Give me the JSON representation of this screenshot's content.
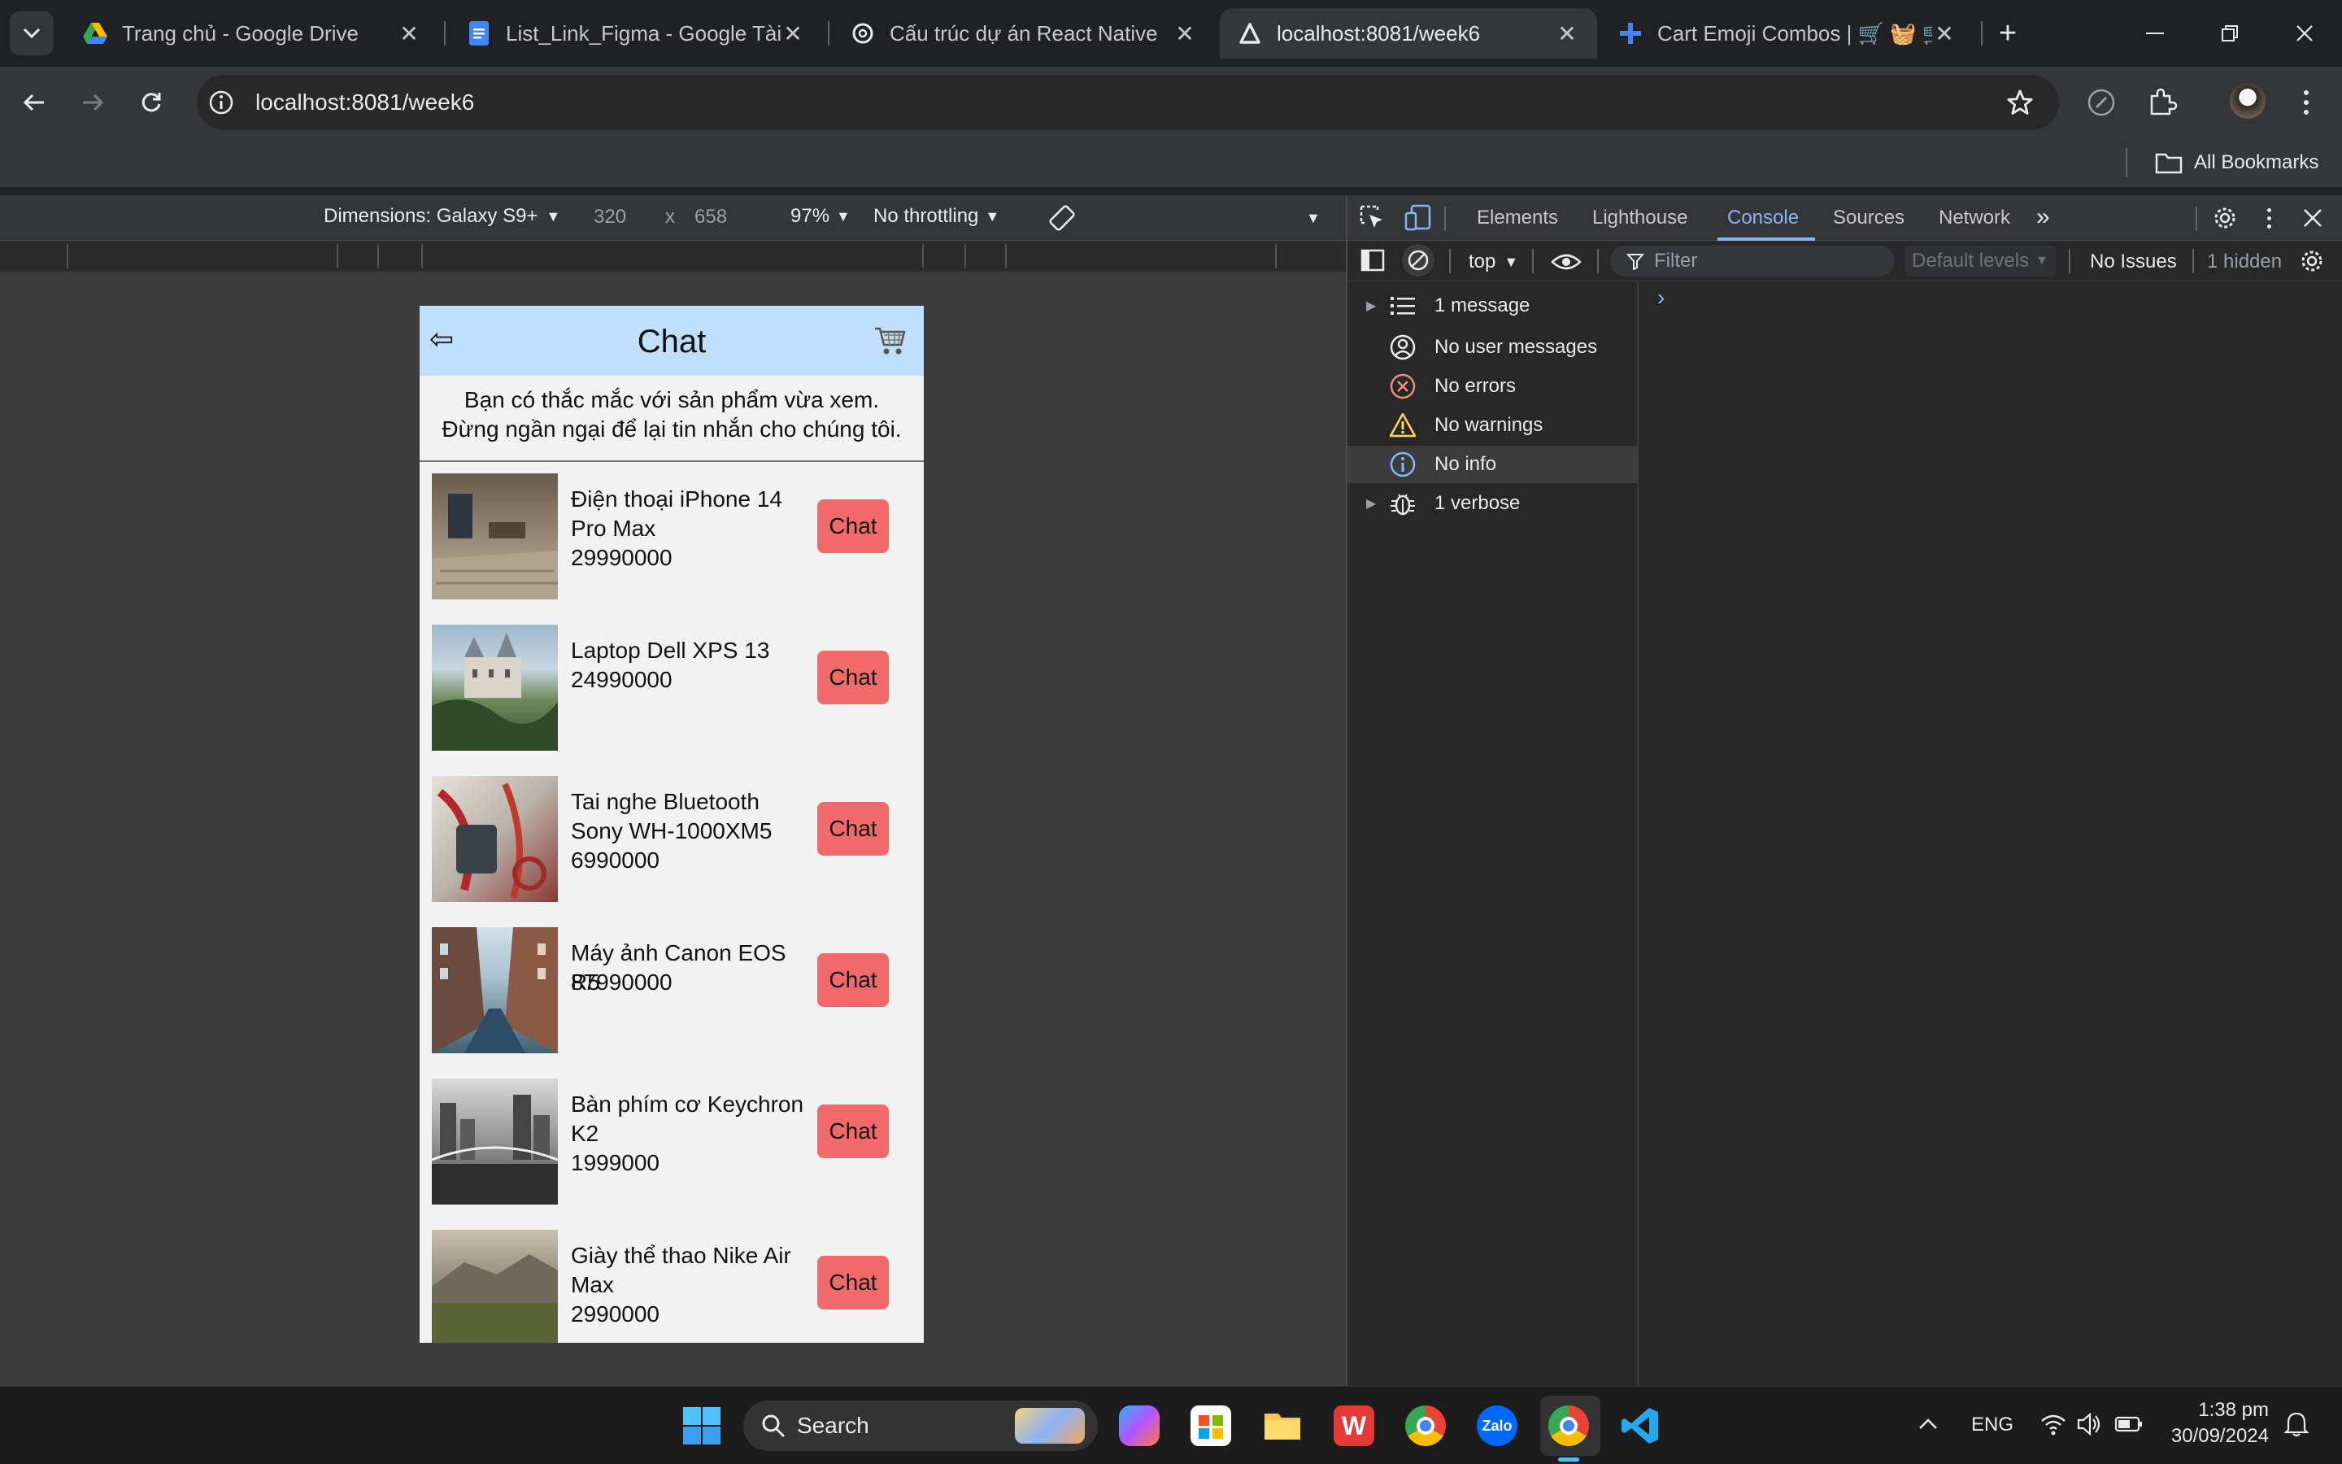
{
  "browser": {
    "tabs": [
      {
        "title": "Trang chủ - Google Drive",
        "icon": "google-drive-icon"
      },
      {
        "title": "List_Link_Figma - Google Tài liệ",
        "icon": "google-docs-icon"
      },
      {
        "title": "Cấu trúc dự án React Native",
        "icon": "chatgpt-icon"
      },
      {
        "title": "localhost:8081/week6",
        "icon": "expo-icon",
        "active": true
      },
      {
        "title": "Cart Emoji Combos | 🛒 🧺 🛒",
        "icon": "plus-icon"
      }
    ],
    "url": "localhost:8081/week6",
    "bookmarks_label": "All Bookmarks"
  },
  "device_toolbar": {
    "dimensions_label": "Dimensions: Galaxy S9+",
    "width": "320",
    "times": "x",
    "height": "658",
    "zoom": "97%",
    "throttling": "No throttling"
  },
  "app": {
    "header_title": "Chat",
    "back_icon": "⇦",
    "cart_icon": "cart-icon",
    "intro_text": "Bạn có thắc mắc với sản phẩm vừa xem. Đừng ngần ngại để lại tin nhắn cho chúng tôi.",
    "chat_label": "Chat",
    "products": [
      {
        "name_line1": "Điện thoại iPhone 14",
        "name_line2": "Pro Max",
        "price": "29990000"
      },
      {
        "name_line1": "Laptop Dell XPS 13",
        "name_line2": "",
        "price": "24990000"
      },
      {
        "name_line1": "Tai nghe Bluetooth",
        "name_line2": "Sony WH-1000XM5",
        "price": "6990000"
      },
      {
        "name_line1": "Máy ảnh Canon EOS R5",
        "name_line2": "",
        "price": "87990000"
      },
      {
        "name_line1": "Bàn phím cơ Keychron",
        "name_line2": "K2",
        "price": "1999000"
      },
      {
        "name_line1": "Giày thể thao Nike Air",
        "name_line2": "Max",
        "price": "2990000"
      }
    ]
  },
  "devtools": {
    "tabs": [
      "Elements",
      "Lighthouse",
      "Console",
      "Sources",
      "Network"
    ],
    "active_tab": "Console",
    "context": "top",
    "filter_placeholder": "Filter",
    "levels": "Default levels",
    "issues": "No Issues",
    "hidden": "1 hidden",
    "sidebar": [
      {
        "label": "1 message",
        "icon": "list-icon",
        "expandable": true
      },
      {
        "label": "No user messages",
        "icon": "user-icon"
      },
      {
        "label": "No errors",
        "icon": "error-icon"
      },
      {
        "label": "No warnings",
        "icon": "warning-icon"
      },
      {
        "label": "No info",
        "icon": "info-icon",
        "selected": true
      },
      {
        "label": "1 verbose",
        "icon": "bug-icon",
        "expandable": true
      }
    ],
    "prompt": "›"
  },
  "taskbar": {
    "search_label": "Search",
    "language": "ENG",
    "time": "1:38 pm",
    "date": "30/09/2024"
  }
}
